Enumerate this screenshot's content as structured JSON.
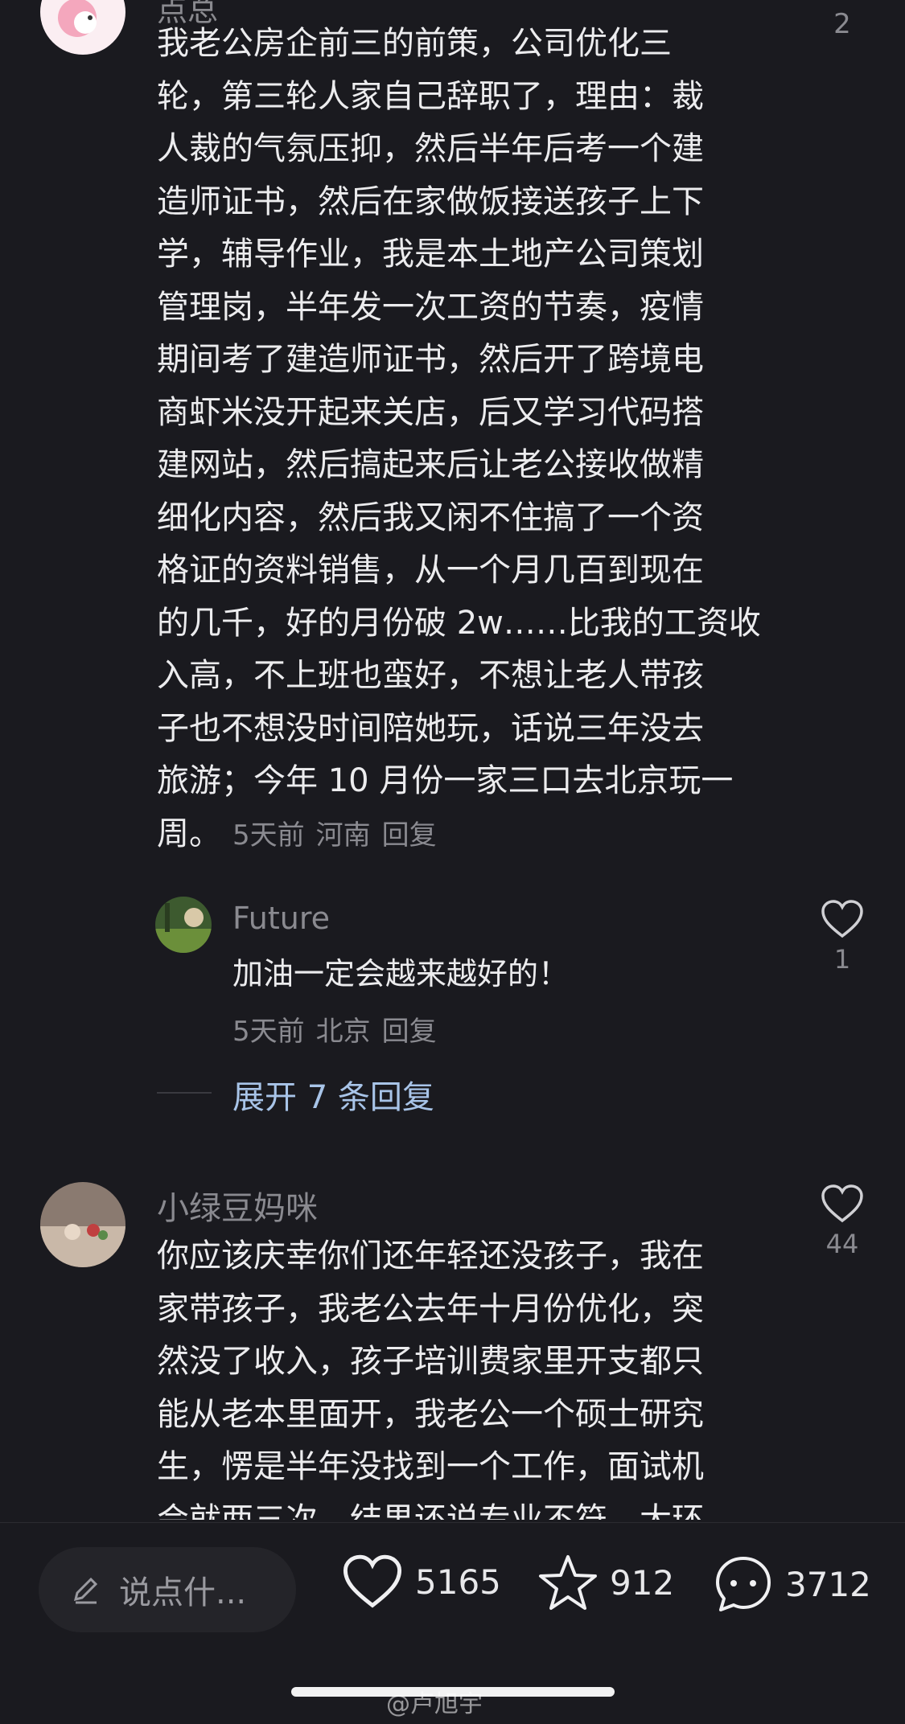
{
  "comment1": {
    "author_partial": "点总",
    "lines": [
      "我老公房企前三的前策，公司优化三",
      "轮，第三轮人家自己辞职了，理由：裁",
      "人裁的气氛压抑，然后半年后考一个建",
      "造师证书，然后在家做饭接送孩子上下",
      "学，辅导作业，我是本土地产公司策划",
      "管理岗，半年发一次工资的节奏，疫情",
      "期间考了建造师证书，然后开了跨境电",
      "商虾米没开起来关店，后又学习代码搭",
      "建网站，然后搞起来后让老公接收做精",
      "细化内容，然后我又闲不住搞了一个资",
      "格证的资料销售，从一个月几百到现在",
      "的几千，好的月份破 2w……比我的工资收",
      "入高，不上班也蛮好，不想让老人带孩",
      "子也不想没时间陪她玩，话说三年没去",
      "旅游；今年 10 月份一家三口去北京玩一"
    ],
    "last_line": "周。",
    "time": "5天前",
    "location": "河南",
    "reply_label": "回复",
    "like_count": "2"
  },
  "reply": {
    "author": "Future",
    "text": "加油一定会越来越好的！",
    "time": "5天前",
    "location": "北京",
    "reply_label": "回复",
    "like_count": "1"
  },
  "expand_label": "展开 7 条回复",
  "comment2": {
    "author": "小绿豆妈咪",
    "lines": [
      "你应该庆幸你们还年轻还没孩子，我在",
      "家带孩子，我老公去年十月份优化，突",
      "然没了收入，孩子培训费家里开支都只",
      "能从老本里面开，我老公一个硕士研究",
      "生，愣是半年没找到一个工作，面试机",
      "会就两三次，结果还说专业不符，大环"
    ],
    "like_count": "44"
  },
  "bottom": {
    "placeholder": "说点什...",
    "likes": "5165",
    "favorites": "912",
    "comments": "3712"
  },
  "watermark": "@卢旭宇",
  "icons": {
    "pen": "edit-pencil-icon",
    "heart": "heart-icon",
    "star": "star-icon",
    "comment": "comment-bubble-icon"
  }
}
